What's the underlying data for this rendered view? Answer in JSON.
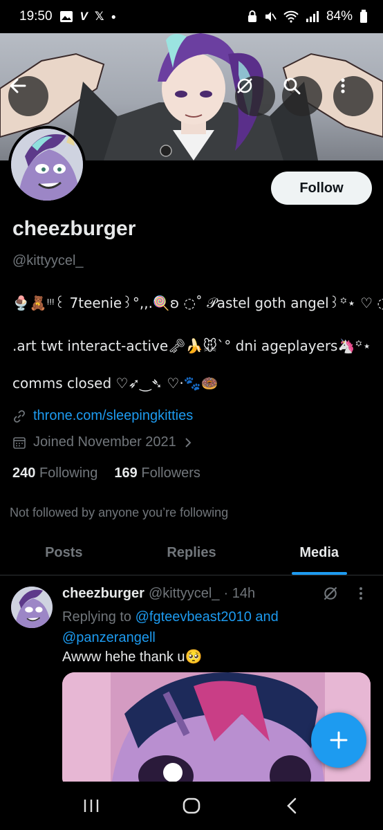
{
  "status_bar": {
    "time": "19:50",
    "battery": "84%",
    "left_icons": [
      "gallery-icon",
      "v-app-icon",
      "x-app-icon",
      "dot-icon"
    ],
    "right_icons": [
      "lock-icon",
      "mute-icon",
      "wifi-icon",
      "signal-icon",
      "battery-icon"
    ]
  },
  "header": {
    "back_icon": "arrow-left-icon",
    "grok_icon": "grok-icon",
    "search_icon": "search-icon",
    "more_icon": "more-vertical-icon"
  },
  "profile": {
    "follow_label": "Follow",
    "display_name": "cheezburger",
    "handle": "@kittyycel_",
    "bio_line1": "🍨🧸ᵎᵎᵎ꒰ 7teenie꒱°,,.🍭ʚ ◌˚ 𝒫astel goth angel꒱꙳⋆ ♡ ◌",
    "bio_line2": ".art twt interact-active🗝🍌🐭ˋ° dni ageplayers🦄꙳⋆",
    "bio_line3": "comms closed ♡➶‿➴ ♡·🐾🍩",
    "link": "throne.com/sleepingkitties",
    "joined": "Joined November 2021",
    "following_count": "240",
    "following_label": "Following",
    "followers_count": "169",
    "followers_label": "Followers",
    "not_followed": "Not followed by anyone you’re following"
  },
  "tabs": [
    {
      "label": "Posts",
      "active": false
    },
    {
      "label": "Replies",
      "active": false
    },
    {
      "label": "Media",
      "active": true
    }
  ],
  "post": {
    "name": "cheezburger",
    "handle": "@kittyycel_",
    "time": "· 14h",
    "replying_prefix": "Replying to",
    "mention1": "@fgteevbeast2010",
    "and_text": "and",
    "mention2": "@panzerangell",
    "text": "Awww hehe thank u🥺"
  },
  "fab_icon": "plus-icon",
  "nav_bar": {
    "recents_icon": "recents-icon",
    "home_icon": "home-icon",
    "back_icon": "nav-back-icon"
  },
  "colors": {
    "background": "#000000",
    "accent": "#1d9bf0",
    "text_primary": "#e7e9ea",
    "text_secondary": "#71767b"
  }
}
